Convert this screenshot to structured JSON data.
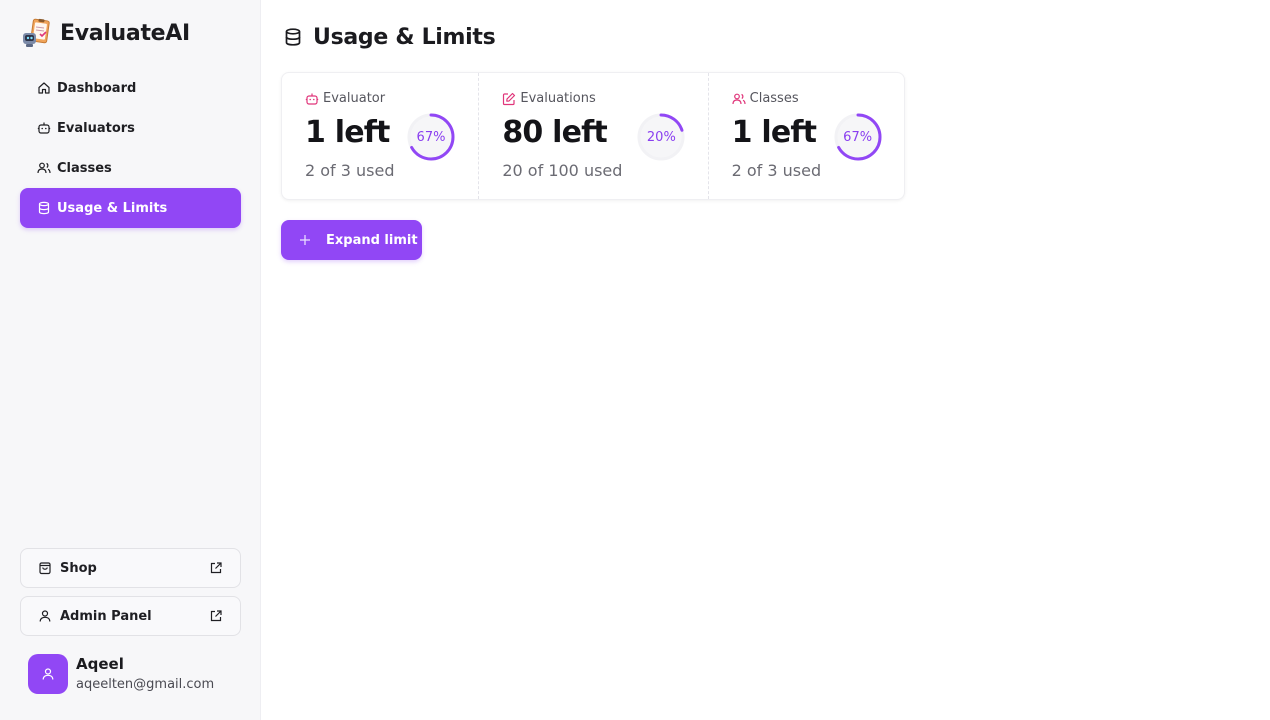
{
  "brand": {
    "name": "EvaluateAI",
    "logo_icon": "clipboard-robot-icon"
  },
  "sidebar": {
    "items": [
      {
        "label": "Dashboard",
        "icon": "home-icon",
        "active": false
      },
      {
        "label": "Evaluators",
        "icon": "robot-icon",
        "active": false
      },
      {
        "label": "Classes",
        "icon": "users-icon",
        "active": false
      },
      {
        "label": "Usage & Limits",
        "icon": "database-icon",
        "active": true
      }
    ],
    "links": [
      {
        "label": "Shop",
        "icon": "shopping-bag-icon"
      },
      {
        "label": "Admin Panel",
        "icon": "user-icon"
      }
    ]
  },
  "user": {
    "name": "Aqeel",
    "email": "aqeelten@gmail.com"
  },
  "page": {
    "title": "Usage & Limits"
  },
  "usage": [
    {
      "label": "Evaluator",
      "icon": "robot-icon",
      "left": "1 left",
      "used": "2 of 3 used",
      "percent_text": "67%",
      "percent": 67
    },
    {
      "label": "Evaluations",
      "icon": "edit-icon",
      "left": "80 left",
      "used": "20 of 100 used",
      "percent_text": "20%",
      "percent": 20
    },
    {
      "label": "Classes",
      "icon": "users-icon",
      "left": "1 left",
      "used": "2 of 3 used",
      "percent_text": "67%",
      "percent": 67
    }
  ],
  "actions": {
    "expand_label": "Expand limit"
  },
  "colors": {
    "accent": "#9147f5",
    "icon_pink": "#e0357a",
    "ring_track": "#f2f2f5"
  }
}
